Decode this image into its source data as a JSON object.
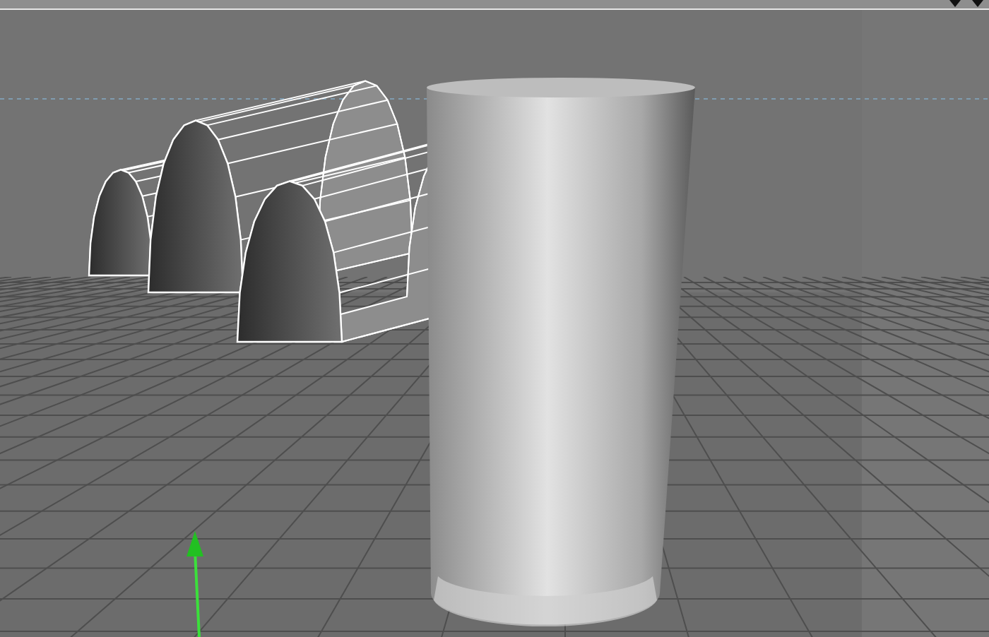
{
  "menu_bar": {
    "icons": [
      {
        "kind": "caret"
      },
      {
        "kind": "caret"
      }
    ]
  },
  "viewport": {
    "objects": [
      {
        "kind": "arches"
      },
      {
        "kind": "cylinder"
      },
      {
        "kind": "axis-arrow"
      }
    ]
  }
}
